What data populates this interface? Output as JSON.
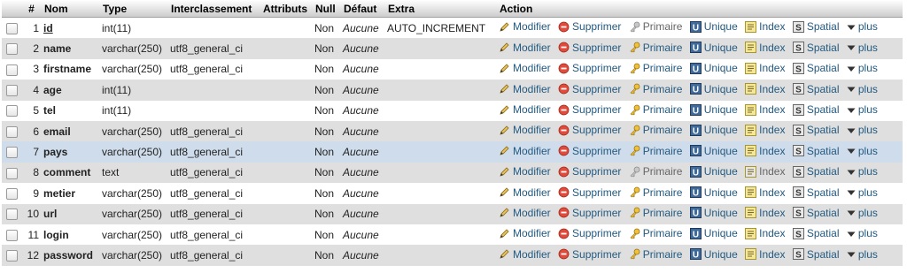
{
  "columns": [
    "",
    "#",
    "Nom",
    "Type",
    "Interclassement",
    "Attributs",
    "Null",
    "Défaut",
    "Extra",
    "Action"
  ],
  "actions": {
    "edit": "Modifier",
    "delete": "Supprimer",
    "primary": "Primaire",
    "unique": "Unique",
    "index": "Index",
    "spatial": "Spatial",
    "more": "plus"
  },
  "rows": [
    {
      "num": "1",
      "name": "id",
      "type": "int(11)",
      "collation": "",
      "attributes": "",
      "null": "Non",
      "default": "Aucune",
      "extra": "AUTO_INCREMENT"
    },
    {
      "num": "2",
      "name": "name",
      "type": "varchar(250)",
      "collation": "utf8_general_ci",
      "attributes": "",
      "null": "Non",
      "default": "Aucune",
      "extra": ""
    },
    {
      "num": "3",
      "name": "firstname",
      "type": "varchar(250)",
      "collation": "utf8_general_ci",
      "attributes": "",
      "null": "Non",
      "default": "Aucune",
      "extra": ""
    },
    {
      "num": "4",
      "name": "age",
      "type": "int(11)",
      "collation": "",
      "attributes": "",
      "null": "Non",
      "default": "Aucune",
      "extra": ""
    },
    {
      "num": "5",
      "name": "tel",
      "type": "int(11)",
      "collation": "",
      "attributes": "",
      "null": "Non",
      "default": "Aucune",
      "extra": ""
    },
    {
      "num": "6",
      "name": "email",
      "type": "varchar(250)",
      "collation": "utf8_general_ci",
      "attributes": "",
      "null": "Non",
      "default": "Aucune",
      "extra": ""
    },
    {
      "num": "7",
      "name": "pays",
      "type": "varchar(250)",
      "collation": "utf8_general_ci",
      "attributes": "",
      "null": "Non",
      "default": "Aucune",
      "extra": ""
    },
    {
      "num": "8",
      "name": "comment",
      "type": "text",
      "collation": "utf8_general_ci",
      "attributes": "",
      "null": "Non",
      "default": "Aucune",
      "extra": ""
    },
    {
      "num": "9",
      "name": "metier",
      "type": "varchar(250)",
      "collation": "utf8_general_ci",
      "attributes": "",
      "null": "Non",
      "default": "Aucune",
      "extra": ""
    },
    {
      "num": "10",
      "name": "url",
      "type": "varchar(250)",
      "collation": "utf8_general_ci",
      "attributes": "",
      "null": "Non",
      "default": "Aucune",
      "extra": ""
    },
    {
      "num": "11",
      "name": "login",
      "type": "varchar(250)",
      "collation": "utf8_general_ci",
      "attributes": "",
      "null": "Non",
      "default": "Aucune",
      "extra": ""
    },
    {
      "num": "12",
      "name": "password",
      "type": "varchar(250)",
      "collation": "utf8_general_ci",
      "attributes": "",
      "null": "Non",
      "default": "Aucune",
      "extra": ""
    }
  ],
  "colors": {
    "link": "#235a81",
    "row_alt": "#dfdfdf",
    "row_highlight": "#cfdceb"
  }
}
